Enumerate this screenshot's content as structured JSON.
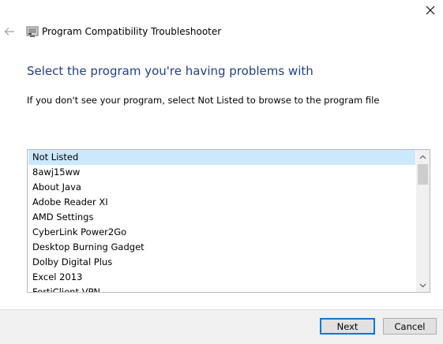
{
  "window": {
    "title": "Program Compatibility Troubleshooter"
  },
  "icons": {
    "close": "close-icon",
    "back": "back-arrow-icon",
    "app": "troubleshooter-app-icon",
    "scroll_up": "chevron-up-icon",
    "scroll_down": "chevron-down-icon"
  },
  "content": {
    "heading": "Select the program you're having problems with",
    "instruction": "If you don't see your program, select Not Listed to browse to the program file"
  },
  "program_list": {
    "selected_index": 0,
    "items": [
      "Not Listed",
      "8awj15ww",
      "About Java",
      "Adobe Reader XI",
      "AMD Settings",
      "CyberLink Power2Go",
      "Desktop Burning Gadget",
      "Dolby Digital Plus",
      "Excel 2013",
      "FortiClient VPN"
    ]
  },
  "buttons": {
    "next": "Next",
    "cancel": "Cancel"
  },
  "colors": {
    "heading": "#203f8a",
    "selection": "#cce8ff",
    "focus_border": "#0078d7",
    "footer_bg": "#f0f0f0"
  }
}
